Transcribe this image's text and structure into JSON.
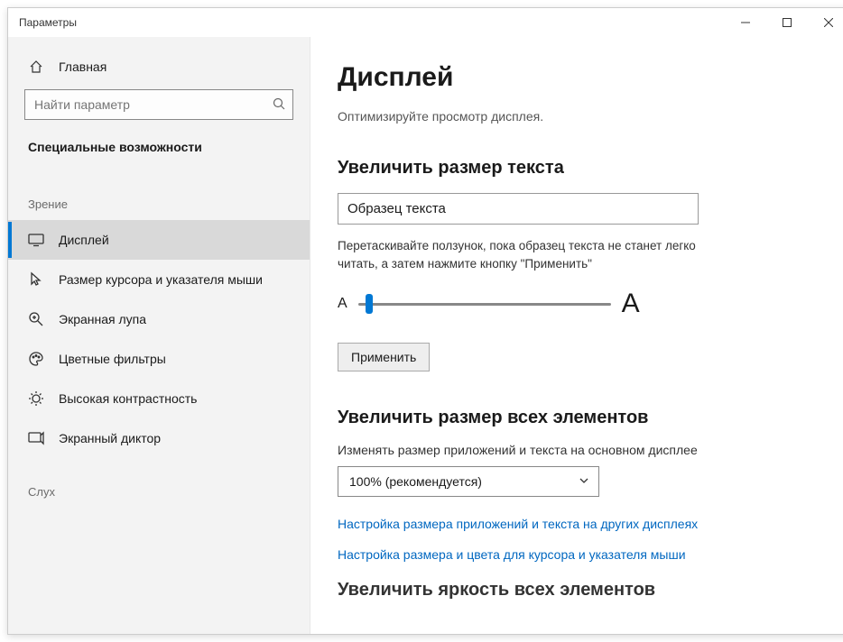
{
  "window": {
    "title": "Параметры"
  },
  "sidebar": {
    "home": "Главная",
    "search_placeholder": "Найти параметр",
    "category": "Специальные возможности",
    "group_vision": "Зрение",
    "group_hearing": "Слух",
    "items": [
      {
        "label": "Дисплей"
      },
      {
        "label": "Размер курсора и указателя мыши"
      },
      {
        "label": "Экранная лупа"
      },
      {
        "label": "Цветные фильтры"
      },
      {
        "label": "Высокая контрастность"
      },
      {
        "label": "Экранный диктор"
      }
    ]
  },
  "main": {
    "title": "Дисплей",
    "subtitle": "Оптимизируйте просмотр дисплея.",
    "text_size": {
      "heading": "Увеличить размер текста",
      "sample": "Образец текста",
      "desc": "Перетаскивайте ползунок, пока образец текста не станет легко читать, а затем нажмите кнопку \"Применить\"",
      "small_a": "A",
      "large_a": "A",
      "apply": "Применить"
    },
    "all_size": {
      "heading": "Увеличить размер всех элементов",
      "label": "Изменять размер приложений и текста на основном дисплее",
      "dropdown_value": "100% (рекомендуется)",
      "link1": "Настройка размера приложений и текста на других дисплеях",
      "link2": "Настройка размера и цвета для курсора и указателя мыши"
    },
    "brightness_heading": "Увеличить яркость всех элементов"
  }
}
